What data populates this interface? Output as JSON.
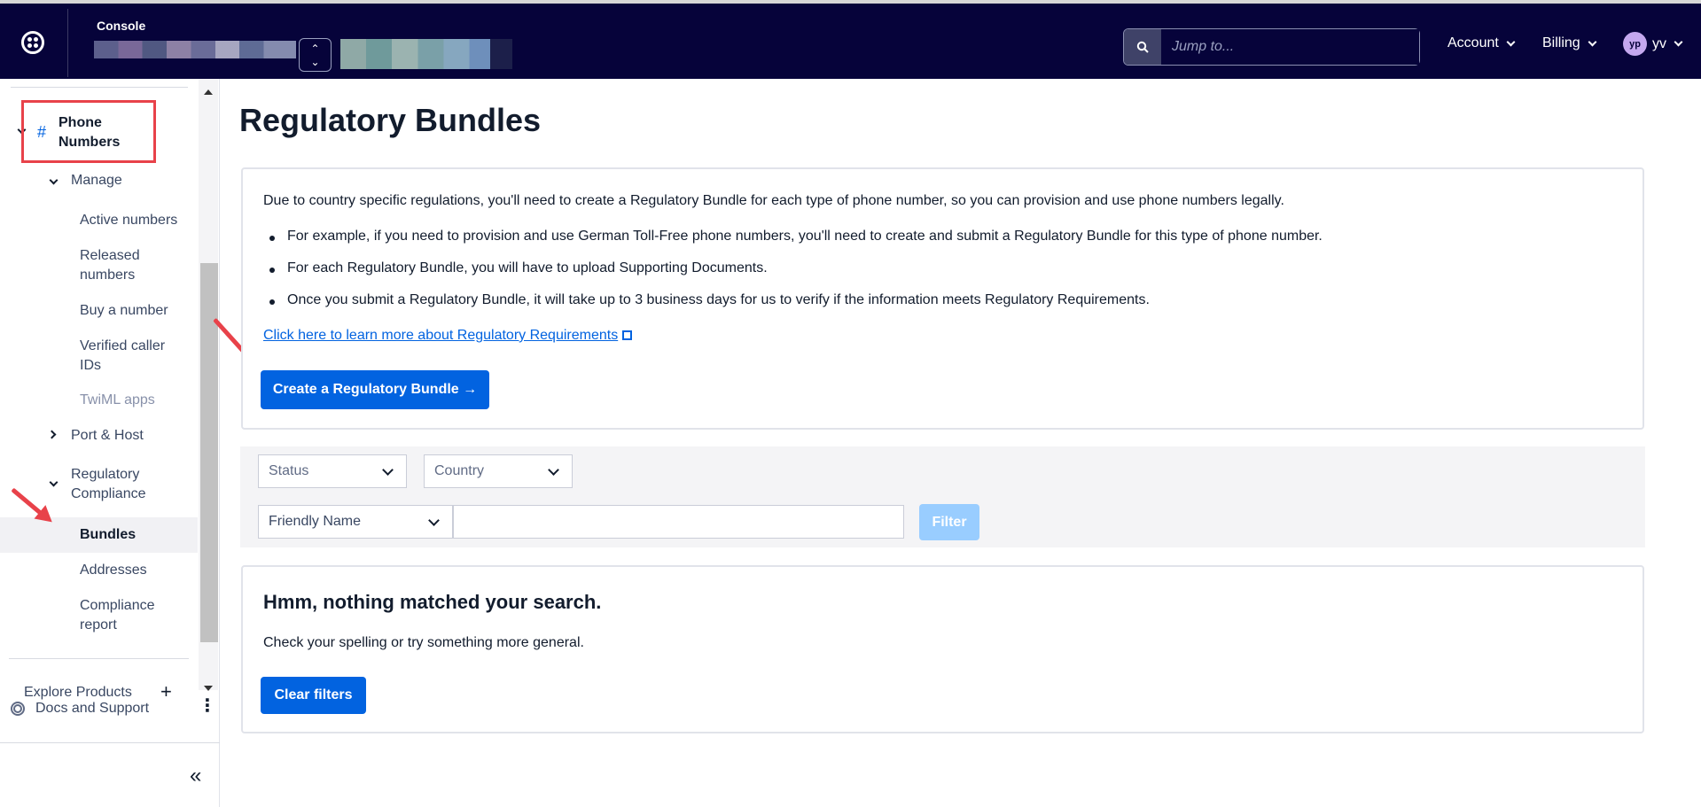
{
  "header": {
    "console_label": "Console",
    "search_placeholder": "Jump to...",
    "nav": {
      "account": "Account",
      "billing": "Billing",
      "user_initials": "yp",
      "user_name": "yv"
    }
  },
  "sidebar": {
    "section_title": "Phone Numbers",
    "manage": "Manage",
    "manage_items": [
      "Active numbers",
      "Released numbers",
      "Buy a number",
      "Verified caller IDs",
      "TwiML apps"
    ],
    "port_host": "Port & Host",
    "regulatory": "Regulatory Compliance",
    "regulatory_items": [
      "Bundles",
      "Addresses",
      "Compliance report"
    ],
    "explore": "Explore Products",
    "docs": "Docs and Support"
  },
  "main": {
    "title": "Regulatory Bundles",
    "intro": "Due to country specific regulations, you'll need to create a Regulatory Bundle for each type of phone number, so you can provision and use phone numbers legally.",
    "bullets": [
      "For example, if you need to provision and use German Toll-Free phone numbers, you'll need to create and submit a Regulatory Bundle for this type of phone number.",
      "For each Regulatory Bundle, you will have to upload Supporting Documents.",
      "Once you submit a Regulatory Bundle, it will take up to 3 business days for us to verify if the information meets Regulatory Requirements."
    ],
    "learn_link": "Click here to learn more about Regulatory Requirements",
    "create_button": "Create a Regulatory Bundle →",
    "filters": {
      "status": "Status",
      "country": "Country",
      "friendly_name": "Friendly Name",
      "filter_button": "Filter"
    },
    "empty": {
      "title": "Hmm, nothing matched your search.",
      "text": "Check your spelling or try something more general.",
      "clear_button": "Clear filters"
    }
  },
  "colors": {
    "topbar": "#06033a",
    "primary": "#0263e0",
    "annotation": "#e8424a"
  }
}
